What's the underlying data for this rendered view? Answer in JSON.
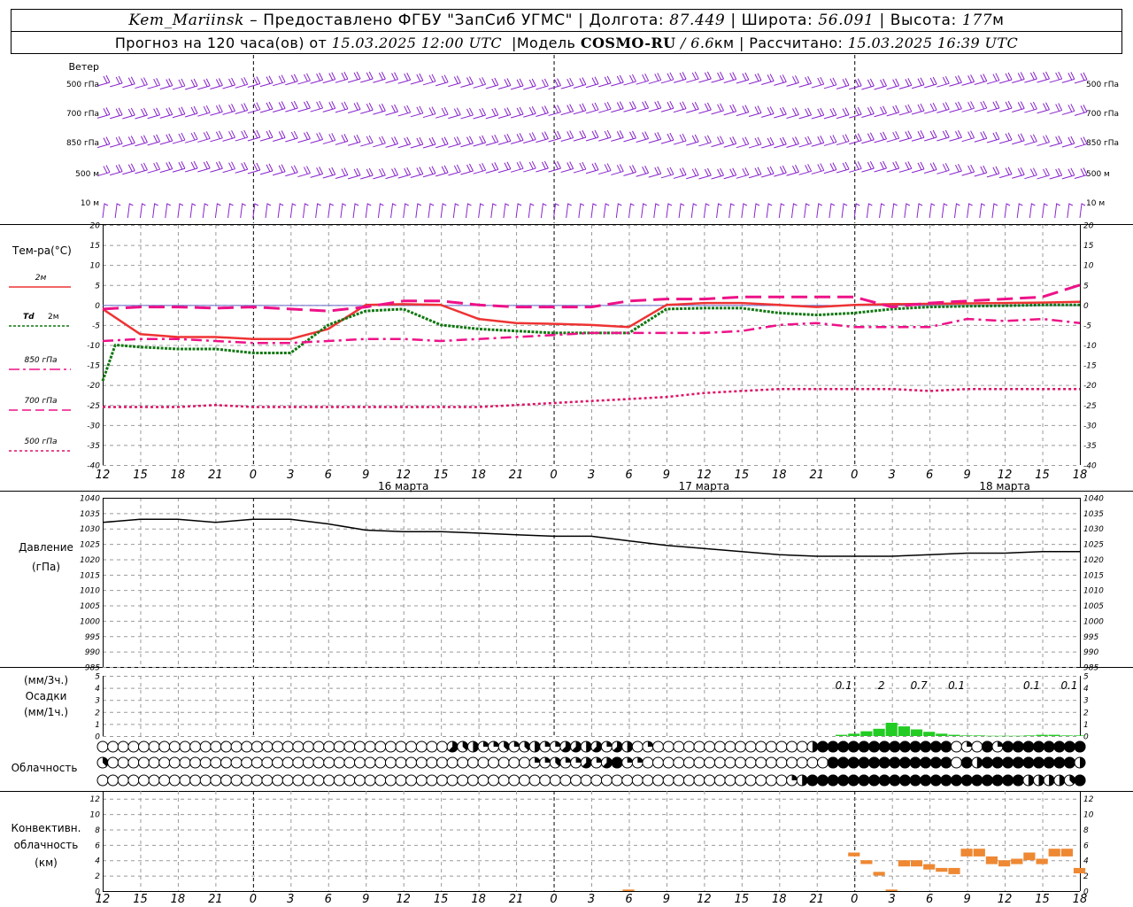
{
  "header": {
    "station": "Kem_Mariinsk",
    "dash": "–",
    "provider": "Предоставлено ФГБУ \"ЗапСиб УГМС\"",
    "sep": "|",
    "lon_label": "Долгота:",
    "lon_value": "87.449",
    "lat_label": "Широта:",
    "lat_value": "56.091",
    "alt_label": "Высота:",
    "alt_value": "177",
    "alt_unit": "м",
    "fc_prefix": "Прогноз на 120 часа(ов) от",
    "fc_start": "15.03.2025 12:00 UTC",
    "model_label": "Модель",
    "model_name": "COSMO-RU",
    "model_slash": "/",
    "model_res": "6.6",
    "model_res_unit": "км",
    "calc_label": "Рассчитано:",
    "calc_time": "15.03.2025 16:39 UTC"
  },
  "x_ticks": [
    "12",
    "15",
    "18",
    "21",
    "0",
    "3",
    "6",
    "9",
    "12",
    "15",
    "18",
    "21",
    "0",
    "3",
    "6",
    "9",
    "12",
    "15",
    "18",
    "21",
    "0",
    "3",
    "6",
    "9",
    "12",
    "15",
    "18"
  ],
  "day_labels": [
    {
      "tick": 8,
      "text": "16 марта"
    },
    {
      "tick": 16,
      "text": "17 марта"
    },
    {
      "tick": 24,
      "text": "18 марта"
    }
  ],
  "colors": {
    "t2m": "#ee3333",
    "td2m": "#117711",
    "t850": "#ee1188",
    "t700": "#ee1188",
    "t500": "#dd1166",
    "pressure": "#000000",
    "precip": "#22cc22",
    "precip_dark": "#118811",
    "conv": "#ee8833",
    "wind": "#8822cc",
    "grid": "#999999"
  },
  "wind_panel": {
    "title": "Ветер",
    "levels": [
      "500 гПа",
      "700 гПа",
      "850 гПа",
      "500 м",
      "10 м"
    ]
  },
  "temp_panel": {
    "title": "Тем-ра(°C)",
    "legend": [
      {
        "label": "2м",
        "style": "solid"
      },
      {
        "label": "Td",
        "label2": "2м",
        "style": "dot"
      },
      {
        "label": "850 гПа",
        "style": "dashdot"
      },
      {
        "label": "700 гПа",
        "style": "dash"
      },
      {
        "label": "500 гПа",
        "style": "dotted"
      }
    ]
  },
  "pressure_panel": {
    "label1": "Давление",
    "label2": "(гПа)"
  },
  "precip_panel": {
    "label1": "(мм/3ч.)",
    "label2": "Осадки",
    "label3": "(мм/1ч.)",
    "annotations": [
      {
        "hour": 60,
        "text": "0.1"
      },
      {
        "hour": 63,
        "text": "2"
      },
      {
        "hour": 66,
        "text": "0.7"
      },
      {
        "hour": 69,
        "text": "0.1"
      },
      {
        "hour": 75,
        "text": "0.1"
      },
      {
        "hour": 78,
        "text": "0.1"
      }
    ]
  },
  "cloud_panel": {
    "label": "Облачность"
  },
  "conv_panel": {
    "label1": "Конвективн.",
    "label2": "облачность",
    "label3": "(км)"
  },
  "chart_data": [
    {
      "type": "line",
      "title": "Тем-ра(°C)",
      "x_unit": "hours from 15.03.2025 12:00 UTC",
      "ylim": [
        -40,
        20
      ],
      "yticks": [
        -40,
        -35,
        -30,
        -25,
        -20,
        -15,
        -10,
        -5,
        0,
        5,
        10,
        15,
        20
      ],
      "grid": true,
      "series": [
        {
          "name": "2м",
          "x": [
            0,
            3,
            6,
            9,
            12,
            15,
            18,
            21,
            24,
            27,
            30,
            33,
            36,
            39,
            42,
            45,
            48,
            51,
            54,
            57,
            60,
            63,
            66,
            69,
            72,
            75,
            78
          ],
          "y": [
            -1,
            -7.3,
            -8,
            -8,
            -8.5,
            -8.5,
            -6,
            0,
            0.2,
            0,
            -3.5,
            -4.5,
            -4.7,
            -5,
            -5.5,
            0,
            0.5,
            0.5,
            0,
            -0.5,
            0,
            0.2,
            0.3,
            0.4,
            0.5,
            0.6,
            0.8
          ]
        },
        {
          "name": "Td 2м",
          "x": [
            0,
            1,
            3,
            6,
            9,
            12,
            15,
            18,
            21,
            24,
            27,
            30,
            33,
            36,
            39,
            42,
            45,
            48,
            51,
            54,
            57,
            60,
            63,
            66,
            69,
            72,
            75,
            78
          ],
          "y": [
            -19,
            -10,
            -10.5,
            -11,
            -11,
            -12,
            -12,
            -5,
            -1.5,
            -1,
            -5,
            -6,
            -6.5,
            -7,
            -7,
            -7,
            -1,
            -0.8,
            -0.8,
            -2,
            -2.5,
            -2,
            -1,
            -0.5,
            -0.3,
            -0.2,
            0,
            0
          ]
        },
        {
          "name": "850 гПа",
          "x": [
            0,
            3,
            6,
            9,
            12,
            15,
            18,
            21,
            24,
            27,
            30,
            33,
            36,
            39,
            42,
            45,
            48,
            51,
            54,
            57,
            60,
            63,
            66,
            69,
            72,
            75,
            78
          ],
          "y": [
            -9,
            -8.5,
            -8.5,
            -9,
            -9.5,
            -9.5,
            -9,
            -8.5,
            -8.5,
            -9,
            -8.5,
            -8,
            -7.5,
            -7,
            -7,
            -7,
            -7,
            -6.5,
            -5,
            -4.5,
            -5.5,
            -5.5,
            -5.5,
            -3.5,
            -4,
            -3.5,
            -4.5
          ]
        },
        {
          "name": "700 гПа",
          "x": [
            0,
            3,
            6,
            9,
            12,
            15,
            18,
            21,
            24,
            27,
            30,
            33,
            36,
            39,
            42,
            45,
            48,
            51,
            54,
            57,
            60,
            63,
            66,
            69,
            72,
            75,
            78
          ],
          "y": [
            -1,
            -0.5,
            -0.5,
            -0.8,
            -0.5,
            -1,
            -1.5,
            -0.5,
            1,
            1,
            0,
            -0.5,
            -0.5,
            -0.5,
            1,
            1.5,
            1.5,
            2,
            2,
            2,
            2,
            -0.5,
            0.5,
            1,
            1.5,
            2,
            5
          ]
        },
        {
          "name": "500 гПа",
          "x": [
            0,
            3,
            6,
            9,
            12,
            15,
            18,
            21,
            24,
            27,
            30,
            33,
            36,
            39,
            42,
            45,
            48,
            51,
            54,
            57,
            60,
            63,
            66,
            69,
            72,
            75,
            78
          ],
          "y": [
            -25.5,
            -25.5,
            -25.5,
            -25,
            -25.5,
            -25.5,
            -25.5,
            -25.5,
            -25.5,
            -25.5,
            -25.5,
            -25,
            -24.5,
            -24,
            -23.5,
            -23,
            -22,
            -21.5,
            -21,
            -21,
            -21,
            -21,
            -21.5,
            -21,
            -21,
            -21,
            -21
          ]
        }
      ]
    },
    {
      "type": "line",
      "title": "Давление",
      "ylabel": "(гПа)",
      "x_unit": "hours from 15.03.2025 12:00 UTC",
      "ylim": [
        985,
        1040
      ],
      "yticks": [
        985,
        990,
        995,
        1000,
        1005,
        1010,
        1015,
        1020,
        1025,
        1030,
        1035,
        1040
      ],
      "grid": true,
      "series": [
        {
          "name": "Давление",
          "x": [
            0,
            3,
            6,
            9,
            12,
            15,
            18,
            21,
            24,
            27,
            30,
            33,
            36,
            39,
            42,
            45,
            48,
            51,
            54,
            57,
            60,
            63,
            66,
            69,
            72,
            75,
            78
          ],
          "y": [
            1032,
            1033,
            1033,
            1032,
            1033,
            1033,
            1031.5,
            1029.5,
            1029,
            1029,
            1028.5,
            1028,
            1027.5,
            1027.5,
            1026,
            1024.5,
            1023.5,
            1022.5,
            1021.5,
            1021,
            1021,
            1021,
            1021.5,
            1022,
            1022,
            1022.5,
            1022.5
          ]
        }
      ]
    },
    {
      "type": "bar",
      "title": "Осадки",
      "ylabel": "(мм/3ч.) (мм/1ч.)",
      "x_unit": "hours from 15.03.2025 12:00 UTC",
      "ylim": [
        0,
        5
      ],
      "yticks": [
        0,
        1,
        2,
        3,
        4,
        5
      ],
      "grid": true,
      "series": [
        {
          "name": "Осадки",
          "x": [
            59,
            60,
            61,
            62,
            63,
            64,
            65,
            66,
            67,
            68,
            69,
            70,
            71,
            72,
            73,
            74,
            75,
            76,
            77,
            78
          ],
          "y": [
            0.1,
            0.2,
            0.4,
            0.6,
            1.1,
            0.8,
            0.55,
            0.35,
            0.2,
            0.1,
            0.05,
            0.05,
            0.02,
            0.02,
            0.02,
            0.05,
            0.1,
            0.1,
            0.05,
            0.05
          ]
        }
      ]
    },
    {
      "type": "table",
      "title": "Облачность",
      "x_unit": "hours from 15.03.2025 12:00 UTC",
      "rows": [
        {
          "row": 1,
          "octas": [
            0,
            0,
            0,
            0,
            0,
            0,
            0,
            0,
            0,
            0,
            0,
            0,
            0,
            0,
            0,
            0,
            0,
            0,
            0,
            0,
            0,
            0,
            0,
            0,
            0,
            0,
            0,
            0,
            0,
            0,
            0,
            0,
            0,
            0,
            5,
            3,
            4,
            2,
            2,
            3,
            2,
            3,
            4,
            2,
            2,
            5,
            5,
            4,
            5,
            2,
            5,
            4,
            0,
            2,
            0,
            0,
            0,
            0,
            0,
            0,
            0,
            0,
            0,
            0,
            0,
            0,
            0,
            0,
            0,
            4,
            8,
            8,
            8,
            8,
            8,
            8,
            8,
            8,
            8,
            8,
            8,
            8,
            8,
            0,
            2,
            0,
            8,
            2,
            8,
            8,
            8,
            8,
            8,
            8,
            8,
            8
          ]
        },
        {
          "row": 2,
          "octas": [
            3,
            0,
            0,
            0,
            0,
            0,
            0,
            0,
            0,
            0,
            0,
            0,
            0,
            0,
            0,
            0,
            0,
            0,
            0,
            0,
            0,
            0,
            0,
            0,
            0,
            0,
            0,
            0,
            0,
            0,
            0,
            0,
            0,
            0,
            0,
            0,
            0,
            0,
            0,
            0,
            0,
            0,
            2,
            2,
            3,
            2,
            2,
            5,
            2,
            5,
            8,
            2,
            2,
            0,
            0,
            0,
            0,
            0,
            0,
            0,
            0,
            0,
            0,
            0,
            0,
            0,
            0,
            0,
            0,
            0,
            0,
            8,
            8,
            8,
            8,
            8,
            8,
            8,
            8,
            8,
            8,
            8,
            8,
            0,
            8,
            4,
            8,
            8,
            8,
            8,
            8,
            8,
            8,
            8,
            8,
            4
          ]
        },
        {
          "row": 3,
          "octas": [
            0,
            0,
            0,
            0,
            0,
            0,
            0,
            0,
            0,
            0,
            0,
            0,
            0,
            0,
            0,
            0,
            0,
            0,
            0,
            0,
            0,
            0,
            0,
            0,
            0,
            0,
            0,
            0,
            0,
            0,
            0,
            0,
            0,
            0,
            0,
            0,
            0,
            0,
            0,
            0,
            0,
            0,
            0,
            0,
            0,
            0,
            0,
            0,
            0,
            0,
            0,
            0,
            0,
            0,
            0,
            0,
            0,
            0,
            0,
            0,
            0,
            0,
            0,
            0,
            0,
            0,
            0,
            2,
            4,
            8,
            8,
            8,
            8,
            8,
            8,
            8,
            8,
            8,
            8,
            8,
            8,
            8,
            8,
            8,
            8,
            8,
            8,
            8,
            8,
            8,
            4,
            4,
            4,
            4,
            3,
            8
          ]
        }
      ]
    },
    {
      "type": "bar",
      "title": "Конвективн. облачность",
      "ylabel": "(км)",
      "x_unit": "hours from 15.03.2025 12:00 UTC",
      "ylim": [
        0,
        13
      ],
      "yticks": [
        0,
        2,
        4,
        6,
        8,
        10,
        12
      ],
      "grid": true,
      "series": [
        {
          "name": "Конвективн. облачность",
          "x": [
            42,
            60,
            61,
            62,
            63,
            64,
            65,
            66,
            67,
            68,
            69,
            70,
            71,
            72,
            73,
            74,
            75,
            76,
            77,
            78
          ],
          "base": [
            0,
            4.5,
            3.5,
            2,
            0,
            3.2,
            3.2,
            2.8,
            2.5,
            2.2,
            4.5,
            4.5,
            3.5,
            3.2,
            3.5,
            4,
            3.5,
            4.5,
            4.5,
            2.3
          ],
          "top": [
            0.2,
            5,
            4,
            2.5,
            0.2,
            4,
            4,
            3.5,
            3,
            3,
            5.5,
            5.5,
            4.5,
            4,
            4.2,
            5,
            4.2,
            5.5,
            5.5,
            3
          ]
        }
      ]
    }
  ]
}
